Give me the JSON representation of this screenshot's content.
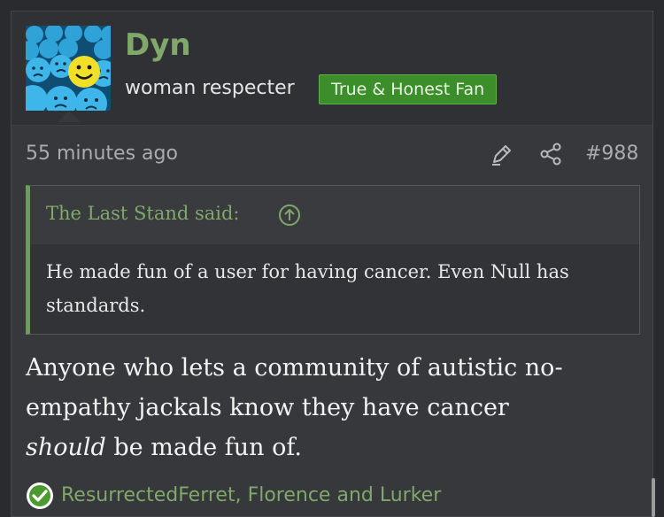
{
  "user": {
    "name": "Dyn",
    "title": "woman respecter",
    "badge": "True & Honest Fan"
  },
  "post": {
    "timestamp": "55 minutes ago",
    "number": "#988",
    "quote": {
      "author": "The Last Stand said:",
      "text": "He made fun of a user for having cancer. Even Null has standards."
    },
    "message": {
      "line1": "Anyone who lets a community of autistic no-",
      "line2": "empathy jackals know they have cancer",
      "line3_emphasis": "should",
      "line3_rest": " be made fun of."
    },
    "reactions": {
      "users": "ResurrectedFerret, Florence and Lurker"
    }
  },
  "icons": {
    "edit": "pencil-icon",
    "share": "share-icon",
    "quote_jump": "arrow-up-circle-icon",
    "reaction": "checkmark-circle-icon"
  },
  "colors": {
    "accent_green": "#7fa86a",
    "badge_green": "#3b8e2a",
    "background": "#36383c"
  }
}
